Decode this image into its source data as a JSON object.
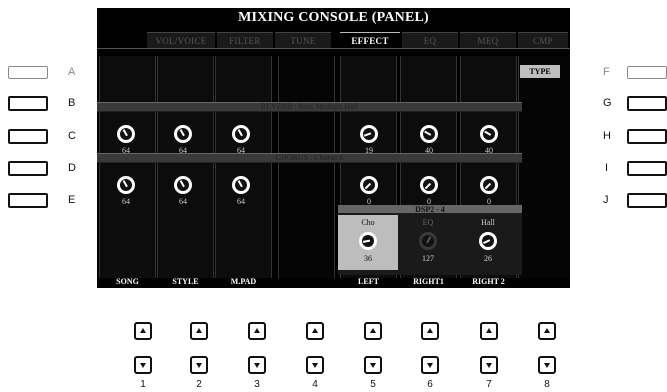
{
  "screen": {
    "title": "MIXING CONSOLE (PANEL)",
    "tabs": [
      {
        "label": "VOL/VOICE",
        "active": false
      },
      {
        "label": "FILTER",
        "active": false
      },
      {
        "label": "TUNE",
        "active": false
      },
      {
        "label": "EFFECT",
        "active": true
      },
      {
        "label": "EQ",
        "active": false
      },
      {
        "label": "MEQ",
        "active": false
      },
      {
        "label": "CMP",
        "active": false
      }
    ],
    "reverb_label": "REVERB : Real Medium Hall",
    "chorus_label": "CHORUS : Chorus 6",
    "type_button": "TYPE",
    "reverb_values": [
      "64",
      "64",
      "64",
      "19",
      "40",
      "40"
    ],
    "chorus_values": [
      "64",
      "64",
      "64",
      "0",
      "0",
      "0"
    ],
    "dsp": {
      "header": "DSP2 - 4",
      "items": [
        {
          "label": "Cho",
          "value": "36",
          "selected": true
        },
        {
          "label": "EQ",
          "value": "127",
          "selected": false
        },
        {
          "label": "Hall",
          "value": "26",
          "selected": false
        }
      ]
    },
    "footer_labels": [
      "SONG",
      "STYLE",
      "M.PAD",
      "",
      "LEFT",
      "RIGHT1",
      "RIGHT 2",
      ""
    ]
  },
  "side_buttons": {
    "left": [
      "A",
      "B",
      "C",
      "D",
      "E"
    ],
    "right": [
      "F",
      "G",
      "H",
      "I",
      "J"
    ]
  },
  "bottom_buttons": [
    "1",
    "2",
    "3",
    "4",
    "5",
    "6",
    "7",
    "8"
  ],
  "colors": {
    "screen_bg": "#000000",
    "accent": "#bfbfbf"
  }
}
